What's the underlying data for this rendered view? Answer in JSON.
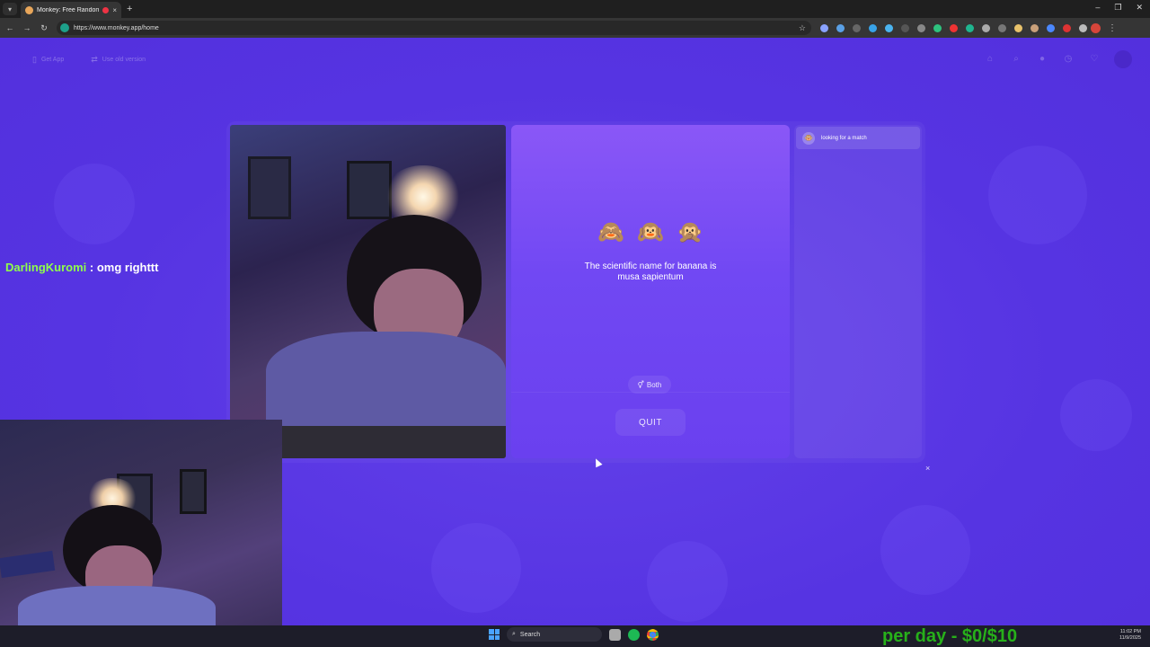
{
  "browser": {
    "tab_title": "Monkey: Free Random Vid",
    "tab_close": "×",
    "new_tab": "+",
    "url": "https://www.monkey.app/home",
    "window_controls": [
      "–",
      "❐",
      "✕"
    ]
  },
  "header": {
    "get_app_label": "Get App",
    "old_version_label": "Use old version"
  },
  "call": {
    "emojis": [
      "🙈",
      "🙉",
      "🙊"
    ],
    "fact_text": "The scientific name for banana is musa sapientum",
    "filter_label": "Both",
    "quit_label": "QUIT"
  },
  "chat_panel": {
    "status_text": "looking for a match",
    "close_label": "×"
  },
  "stream_overlay": {
    "chat_user": "DarlingKuromi",
    "chat_message": " : omg righttt",
    "earnings_text": "per day - $0/$10"
  },
  "taskbar": {
    "search_placeholder": "Search",
    "time": "11:02 PM",
    "date": "11/9/2025"
  },
  "colors": {
    "page_bg": "#5a35e6",
    "panel_accent": "#8a57f7",
    "chat_user": "#8fff4a",
    "earnings": "#27b01a"
  }
}
